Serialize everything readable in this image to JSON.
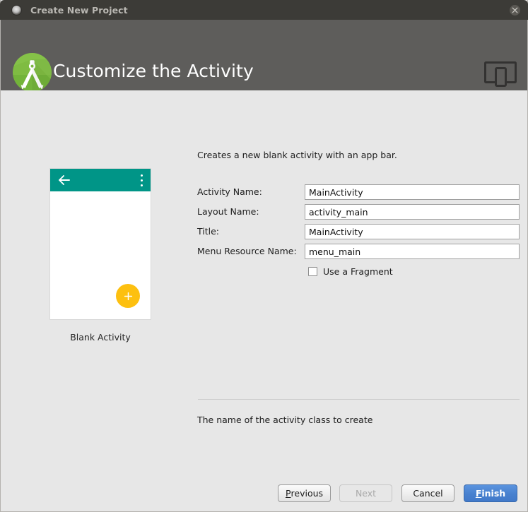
{
  "titlebar": {
    "title": "Create New Project",
    "app_icon": "dot-circle-icon",
    "close_icon": "close-icon"
  },
  "header": {
    "title": "Customize the Activity",
    "logo_icon": "android-studio-logo-icon",
    "device_icon": "tablet-phone-icon",
    "background_color": "#5e5d5b"
  },
  "preview": {
    "caption": "Blank Activity",
    "appbar_color": "#009587",
    "fab_color": "#fdc010",
    "back_icon": "arrow-left-icon",
    "overflow_icon": "overflow-menu-icon",
    "fab_icon": "plus-icon"
  },
  "form": {
    "description": "Creates a new blank activity with an app bar.",
    "fields": [
      {
        "label": "Activity Name:",
        "value": "MainActivity"
      },
      {
        "label": "Layout Name:",
        "value": "activity_main"
      },
      {
        "label": "Title:",
        "value": "MainActivity"
      },
      {
        "label": "Menu Resource Name:",
        "value": "menu_main"
      }
    ],
    "checkbox": {
      "label": "Use a Fragment",
      "checked": false
    },
    "help_text": "The name of the activity class to create"
  },
  "footer": {
    "buttons": [
      {
        "label": "Previous",
        "mnemonic": "P",
        "rest": "revious",
        "state": "enabled"
      },
      {
        "label": "Next",
        "mnemonic": "",
        "rest": "Next",
        "state": "disabled"
      },
      {
        "label": "Cancel",
        "mnemonic": "",
        "rest": "Cancel",
        "state": "enabled"
      },
      {
        "label": "Finish",
        "mnemonic": "F",
        "rest": "inish",
        "state": "primary"
      }
    ],
    "primary_color": "#4881cf"
  }
}
